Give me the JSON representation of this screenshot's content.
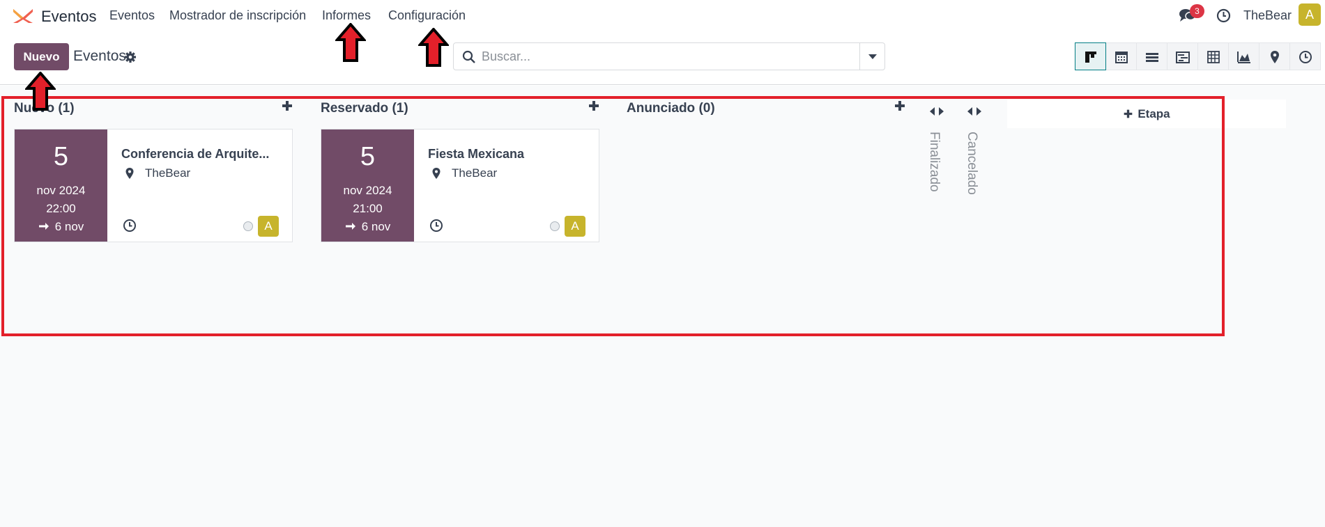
{
  "navbar": {
    "app_name": "Eventos",
    "menu": [
      "Eventos",
      "Mostrador de inscripción",
      "Informes",
      "Configuración"
    ],
    "messages_count": "3",
    "company": "TheBear",
    "user_initial": "A"
  },
  "control": {
    "new_label": "Nuevo",
    "breadcrumb": "Eventos",
    "search_placeholder": "Buscar..."
  },
  "views": [
    "kanban-icon",
    "calendar-icon",
    "list-icon",
    "gantt-icon",
    "pivot-icon",
    "graph-icon",
    "map-icon",
    "activity-icon"
  ],
  "columns": [
    {
      "title": "Nuevo (1)"
    },
    {
      "title": "Reservado (1)"
    },
    {
      "title": "Anunciado (0)"
    }
  ],
  "folded_columns": [
    "Finalizado",
    "Cancelado"
  ],
  "cards": [
    {
      "day": "5",
      "month": "nov 2024",
      "time": "22:00",
      "end": "6 nov",
      "title": "Conferencia de Arquite...",
      "location": "TheBear",
      "avatar": "A"
    },
    {
      "day": "5",
      "month": "nov 2024",
      "time": "21:00",
      "end": "6 nov",
      "title": "Fiesta Mexicana",
      "location": "TheBear",
      "avatar": "A"
    }
  ],
  "add_stage_label": "Etapa",
  "colors": {
    "brand": "#714b67",
    "avatar": "#c7b42c",
    "annotation": "#e3202a",
    "badge": "#dc3545"
  }
}
